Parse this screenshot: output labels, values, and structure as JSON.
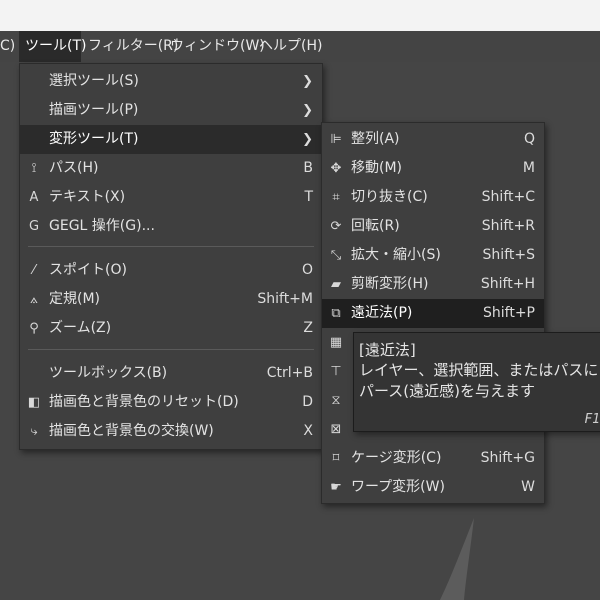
{
  "menubar": [
    {
      "label": "C)"
    },
    {
      "label": "ツール(T)"
    },
    {
      "label": "フィルター(R)"
    },
    {
      "label": "ウィンドウ(W)"
    },
    {
      "label": "ヘルプ(H)"
    }
  ],
  "tools_menu": {
    "items": [
      {
        "label": "選択ツール(S)",
        "icon": "",
        "shortcut": "",
        "submenu": true
      },
      {
        "label": "描画ツール(P)",
        "icon": "",
        "shortcut": "",
        "submenu": true
      },
      {
        "label": "変形ツール(T)",
        "icon": "",
        "shortcut": "",
        "submenu": true
      },
      {
        "label": "パス(H)",
        "icon": "⟟",
        "shortcut": "B"
      },
      {
        "label": "テキスト(X)",
        "icon": "A",
        "shortcut": "T"
      },
      {
        "label": "GEGL 操作(G)...",
        "icon": "G",
        "shortcut": ""
      },
      {
        "label": "スポイト(O)",
        "icon": "⁄",
        "shortcut": "O"
      },
      {
        "label": "定規(M)",
        "icon": "⟑",
        "shortcut": "Shift+M"
      },
      {
        "label": "ズーム(Z)",
        "icon": "⚲",
        "shortcut": "Z"
      },
      {
        "label": "ツールボックス(B)",
        "icon": "",
        "shortcut": "Ctrl+B"
      },
      {
        "label": "描画色と背景色のリセット(D)",
        "icon": "◧",
        "shortcut": "D"
      },
      {
        "label": "描画色と背景色の交換(W)",
        "icon": "⤷",
        "shortcut": "X"
      }
    ]
  },
  "transform_menu": {
    "items": [
      {
        "label": "整列(A)",
        "icon": "⊫",
        "shortcut": "Q"
      },
      {
        "label": "移動(M)",
        "icon": "✥",
        "shortcut": "M"
      },
      {
        "label": "切り抜き(C)",
        "icon": "⌗",
        "shortcut": "Shift+C"
      },
      {
        "label": "回転(R)",
        "icon": "⟳",
        "shortcut": "Shift+R"
      },
      {
        "label": "拡大・縮小(S)",
        "icon": "⤡",
        "shortcut": "Shift+S"
      },
      {
        "label": "剪断変形(H)",
        "icon": "▰",
        "shortcut": "Shift+H"
      },
      {
        "label": "遠近法(P)",
        "icon": "⧉",
        "shortcut": "Shift+P"
      },
      {
        "label": "",
        "icon": "▦",
        "shortcut": ""
      },
      {
        "label": "",
        "icon": "⊤",
        "shortcut": ""
      },
      {
        "label": "",
        "icon": "⧖",
        "shortcut": ""
      },
      {
        "label": "",
        "icon": "⊠",
        "shortcut": ""
      },
      {
        "label": "ケージ変形(C)",
        "icon": "⌑",
        "shortcut": "Shift+G"
      },
      {
        "label": "ワープ変形(W)",
        "icon": "☛",
        "shortcut": "W"
      }
    ]
  },
  "tooltip": {
    "title": "[遠近法]",
    "description": "レイヤー、選択範囲、またはパスにパース(遠近感)を与えます",
    "help_key": "F1"
  }
}
